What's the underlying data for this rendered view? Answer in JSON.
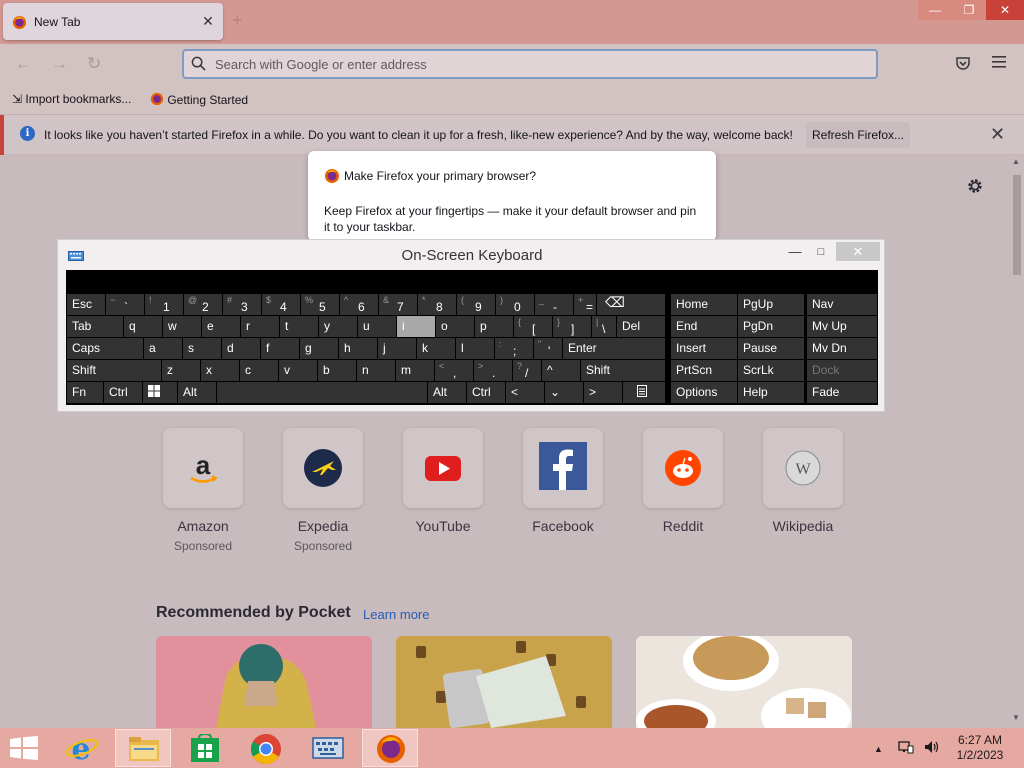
{
  "browser": {
    "tab_title": "New Tab",
    "tab_close": "✕",
    "new_tab": "+",
    "window_controls": {
      "minimize": "—",
      "maximize": "❐",
      "close": "✕"
    }
  },
  "navbar": {
    "back_icon": "back-arrow-icon",
    "forward_icon": "forward-arrow-icon",
    "reload_icon": "reload-icon",
    "search_placeholder": "Search with Google or enter address"
  },
  "bookmarks": {
    "import_label": "Import bookmarks...",
    "getting_started_label": "Getting Started"
  },
  "notification": {
    "message": "It looks like you haven’t started Firefox in a while. Do you want to clean it up for a fresh, like-new experience? And by the way, welcome back!",
    "refresh_button": "Refresh Firefox...",
    "close": "✕"
  },
  "popup": {
    "title": "Make Firefox your primary browser?",
    "body": "Keep Firefox at your fingertips — make it your default browser and pin it to your taskbar."
  },
  "keyboard": {
    "title": "On-Screen Keyboard",
    "minimize": "—",
    "maximize": "□",
    "close": "✕",
    "keys": {
      "esc": "Esc",
      "backquote_main": "`",
      "backquote_shift": "~",
      "k1": "1",
      "k1s": "!",
      "k2": "2",
      "k2s": "@",
      "k3": "3",
      "k3s": "#",
      "k4": "4",
      "k4s": "$",
      "k5": "5",
      "k5s": "%",
      "k6": "6",
      "k6s": "^",
      "k7": "7",
      "k7s": "&",
      "k8": "8",
      "k8s": "*",
      "k9": "9",
      "k9s": "(",
      "k0": "0",
      "k0s": ")",
      "minus": "-",
      "minus_s": "_",
      "equals": "=",
      "equals_s": "+",
      "backspace": "⌫",
      "tab": "Tab",
      "q": "q",
      "w": "w",
      "e": "e",
      "r": "r",
      "t": "t",
      "y": "y",
      "u": "u",
      "i": "i",
      "o": "o",
      "p": "p",
      "lbracket": "[",
      "lbracket_s": "{",
      "rbracket": "]",
      "rbracket_s": "}",
      "backslash": "\\",
      "backslash_s": "|",
      "del": "Del",
      "caps": "Caps",
      "a": "a",
      "s": "s",
      "d": "d",
      "f": "f",
      "g": "g",
      "h": "h",
      "j": "j",
      "k": "k",
      "l": "l",
      "semicolon": ";",
      "semicolon_s": ":",
      "quote": "'",
      "quote_s": "\"",
      "enter": "Enter",
      "shift": "Shift",
      "z": "z",
      "x": "x",
      "c": "c",
      "v": "v",
      "b": "b",
      "n": "n",
      "m": "m",
      "comma": ",",
      "comma_s": "<",
      "period": ".",
      "period_s": ">",
      "slash": "/",
      "slash_s": "?",
      "up": "^",
      "shift_r": "Shift",
      "fn": "Fn",
      "ctrl": "Ctrl",
      "alt": "Alt",
      "alt_r": "Alt",
      "ctrl_r": "Ctrl",
      "left": "<",
      "down": "⌄",
      "right": ">",
      "home": "Home",
      "pgup": "PgUp",
      "nav": "Nav",
      "end": "End",
      "pgdn": "PgDn",
      "mvup": "Mv Up",
      "insert": "Insert",
      "pause": "Pause",
      "mvdn": "Mv Dn",
      "prtscn": "PrtScn",
      "scrlk": "ScrLk",
      "dock": "Dock",
      "options": "Options",
      "help": "Help",
      "fade": "Fade"
    }
  },
  "shortcuts": [
    {
      "name": "Amazon",
      "sponsored": "Sponsored",
      "icon": "amazon-logo"
    },
    {
      "name": "Expedia",
      "sponsored": "Sponsored",
      "icon": "expedia-logo"
    },
    {
      "name": "YouTube",
      "sponsored": "",
      "icon": "youtube-logo"
    },
    {
      "name": "Facebook",
      "sponsored": "",
      "icon": "facebook-logo"
    },
    {
      "name": "Reddit",
      "sponsored": "",
      "icon": "reddit-logo"
    },
    {
      "name": "Wikipedia",
      "sponsored": "",
      "icon": "wikipedia-logo"
    }
  ],
  "pocket": {
    "heading": "Recommended by Pocket",
    "learn_more": "Learn more"
  },
  "taskbar": {
    "clock_time": "6:27 AM",
    "clock_date": "1/2/2023",
    "tray_arrow": "▲"
  }
}
